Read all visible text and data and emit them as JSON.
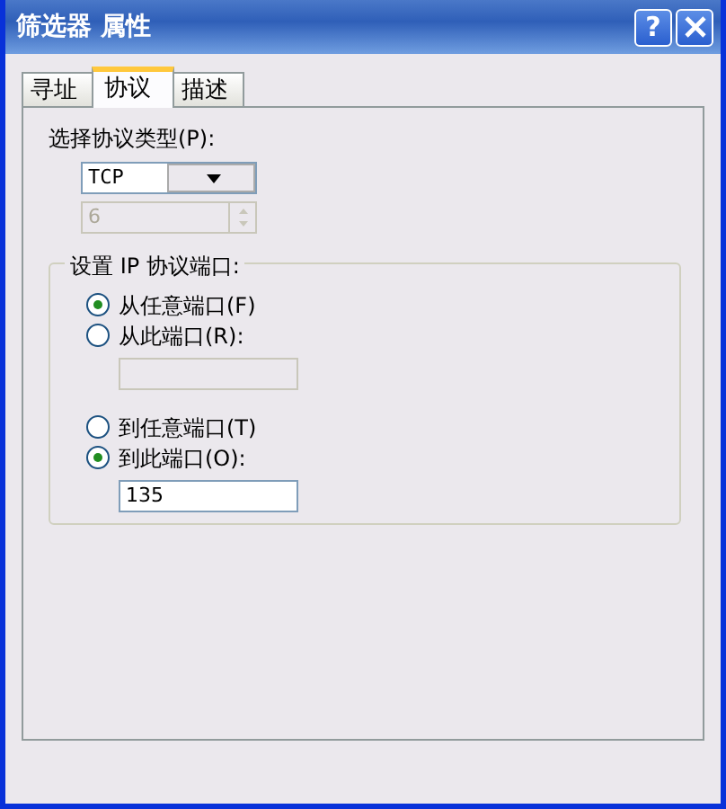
{
  "window": {
    "title": "筛选器 属性",
    "help_label": "?"
  },
  "tabs": [
    {
      "label": "寻址",
      "selected": false
    },
    {
      "label": "协议",
      "selected": true
    },
    {
      "label": "描述",
      "selected": false
    }
  ],
  "protocol_type": {
    "label": "选择协议类型(P):",
    "value": "TCP"
  },
  "protocol_number": {
    "value": "6",
    "disabled": true
  },
  "port_group": {
    "title": "设置 IP 协议端口:",
    "from_options": [
      {
        "label": "从任意端口(F)",
        "selected": true
      },
      {
        "label": "从此端口(R):",
        "selected": false
      }
    ],
    "from_port": {
      "disabled": true
    },
    "to_options": [
      {
        "label": "到任意端口(T)",
        "selected": false
      },
      {
        "label": "到此端口(O):",
        "selected": true
      }
    ],
    "to_port": {
      "value": "135",
      "disabled": false
    }
  }
}
